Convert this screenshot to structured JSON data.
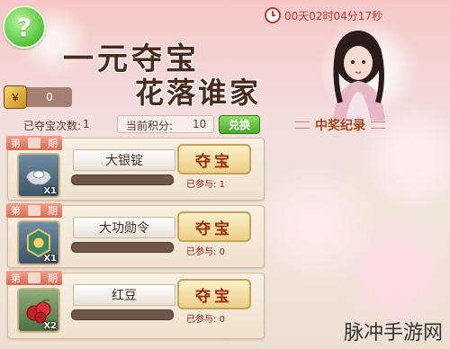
{
  "header": {
    "help_label": "?",
    "title_main": "一元夺宝",
    "title_sub": "花落谁家",
    "timer": "00天02时04分17秒"
  },
  "currency": {
    "value": "0",
    "icon": "coin-icon"
  },
  "stats": {
    "won_label": "已夺宝次数:",
    "won_value": "1",
    "score_label": "当前积分:",
    "score_value": "10",
    "exchange_label": "兑换",
    "records_label": "中奖纪录"
  },
  "items": [
    {
      "round_prefix": "第",
      "round_suffix": "期",
      "name": "大银锭",
      "qty": "X1",
      "button": "夺宝",
      "joined_label": "已参与:",
      "joined_value": "1",
      "icon": "silver-ingot-icon",
      "progress": 0.0
    },
    {
      "round_prefix": "第",
      "round_suffix": "期",
      "name": "大功勋令",
      "qty": "X1",
      "button": "夺宝",
      "joined_label": "已参与:",
      "joined_value": "0",
      "icon": "merit-token-icon",
      "progress": 0.0
    },
    {
      "round_prefix": "第",
      "round_suffix": "期",
      "name": "红豆",
      "qty": "X2",
      "button": "夺宝",
      "joined_label": "已参与:",
      "joined_value": "0",
      "icon": "red-bean-icon",
      "progress": 0.0
    }
  ],
  "watermark": "脉冲手游网",
  "colors": {
    "accent_red": "#c0392b",
    "button_gold": "#eccf86",
    "exchange_green": "#4aa930"
  }
}
